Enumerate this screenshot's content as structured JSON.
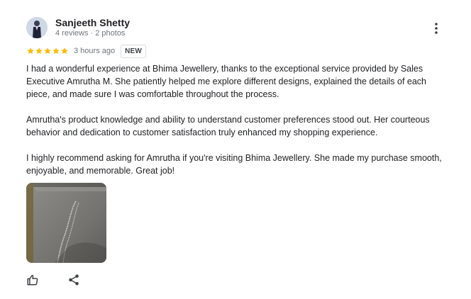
{
  "review": {
    "author": {
      "name": "Sanjeeth Shetty",
      "meta": "4 reviews · 2 photos",
      "avatar_icon": "person-avatar-icon"
    },
    "rating": 5,
    "rating_max": 5,
    "star_color": "#fbbc04",
    "time_ago": "3 hours ago",
    "badge": "NEW",
    "paragraphs": [
      "I had a wonderful experience at Bhima Jewellery, thanks to the exceptional service provided by Sales Executive Amrutha M. She patiently helped me explore different designs, explained the details of each piece, and made sure I was comfortable throughout the process.",
      "Amrutha's product knowledge and ability to understand customer preferences stood out. Her courteous behavior and dedication to customer satisfaction truly enhanced my shopping experience.",
      "I highly recommend asking for Amrutha if you're visiting Bhima Jewellery. She made my purchase smooth, enjoyable, and memorable. Great job!"
    ],
    "photos": [
      {
        "icon": "review-photo-jewellery-chain"
      }
    ]
  },
  "actions": {
    "like_icon": "thumbs-up-icon",
    "share_icon": "share-icon",
    "more_icon": "more-vert-icon"
  }
}
